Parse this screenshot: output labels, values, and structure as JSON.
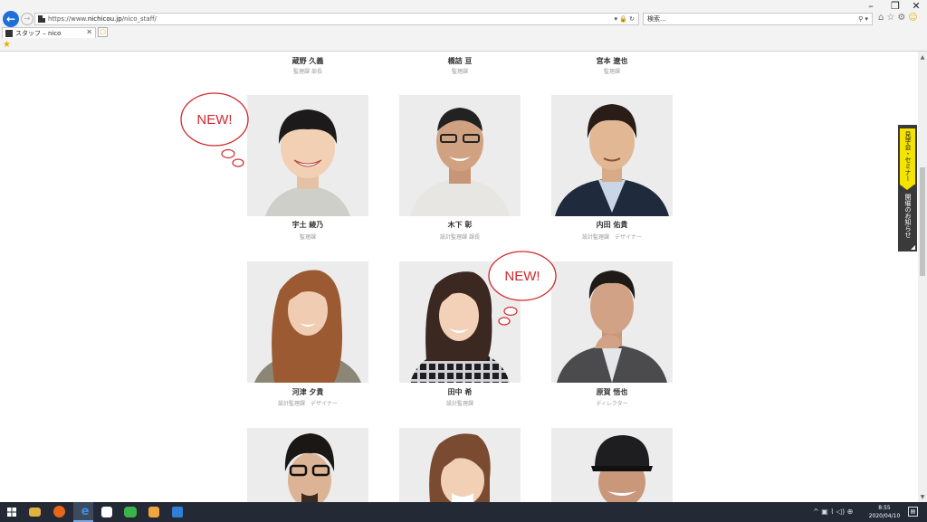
{
  "window": {
    "minimize": "–",
    "restore": "❐",
    "close": "✕"
  },
  "browser": {
    "back": "←",
    "forward": "→",
    "url_prefix": "https://www.",
    "url_domain": "nichicou.jp",
    "url_path": "/nico_staff/",
    "address_icons": "▾ 🔒 ↻",
    "search_placeholder": "検索...",
    "search_icons": "⚲ ▾",
    "toolbar_icons": {
      "home": "⌂",
      "star": "☆",
      "gear": "⚙",
      "smile": "☺"
    },
    "tab_title": "スタッフ – nico",
    "tab_close": "✕",
    "new_tab": "▢",
    "favorites_star": "★"
  },
  "page": {
    "top_row": [
      {
        "name": "蔵野 久義",
        "role": "監理課 部長"
      },
      {
        "name": "橋詰 亘",
        "role": "監理課"
      },
      {
        "name": "宮本 遼也",
        "role": "監理課"
      }
    ],
    "row2": [
      {
        "name": "宇土 綾乃",
        "role": "監理課",
        "new": true
      },
      {
        "name": "木下 彰",
        "role": "設計監理課 課長",
        "new": false
      },
      {
        "name": "内田 佑貴",
        "role": "設計監理課　デザイナー",
        "new": false
      }
    ],
    "row3": [
      {
        "name": "河津 夕貴",
        "role": "設計監理課　デザイナー",
        "new": false
      },
      {
        "name": "田中 希",
        "role": "設計監理課",
        "new": true
      },
      {
        "name": "原賀 悟也",
        "role": "ディレクター",
        "new": false
      }
    ],
    "new_label": "NEW!"
  },
  "ribbon": {
    "highlight": "見学会・セミナー",
    "text": "開催のお知らせ"
  },
  "scrollbar": {
    "up": "▲",
    "down": "▼"
  },
  "taskbar": {
    "tray_icons": "^  ▣  ⌇  ◁)  ⊕",
    "time": "8:55",
    "date": "2020/04/10",
    "notif": "▤"
  },
  "colors": {
    "bubble": "#d0282e",
    "ribbon_bg": "#3a3a3a",
    "ribbon_highlight": "#f5e400",
    "taskbar_bg": "#232a36",
    "browser_back": "#1e6fd9"
  }
}
